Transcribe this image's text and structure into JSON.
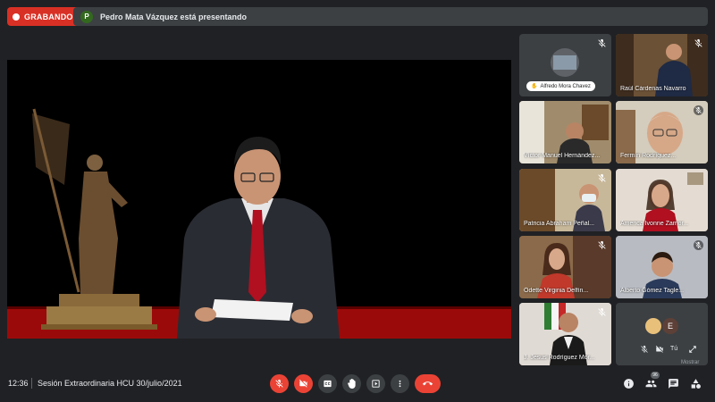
{
  "recording": {
    "label": "GRABANDO"
  },
  "presenting": {
    "avatar_letter": "P",
    "text": "Pedro Mata Vázquez está presentando"
  },
  "participants": [
    {
      "name": "Alfredo Mora Chavez"
    },
    {
      "name": "Raúl Cárdenas Navarro"
    },
    {
      "name": "Víctor Manuel Hernández..."
    },
    {
      "name": "Fermín Rodríguez..."
    },
    {
      "name": "Patricia Abraham Peñal..."
    },
    {
      "name": "America Ivonne Zamor..."
    },
    {
      "name": "Odette Virginia Delfín..."
    },
    {
      "name": "Alberto Gómez Tagle..."
    },
    {
      "name": "J. Jesus Rodríguez Mor..."
    }
  ],
  "self_tile": {
    "avatar_letter": "E",
    "label": "Tú"
  },
  "bottom_bar": {
    "time": "12:36",
    "meeting_title": "Sesión Extraordinaria HCU 30/julio/2021",
    "participants_count": "96",
    "mostrar_label": "Mostrar"
  },
  "colors": {
    "recording": "#d93025",
    "danger": "#ea4335",
    "surface": "#3c4043",
    "background": "#202124"
  }
}
